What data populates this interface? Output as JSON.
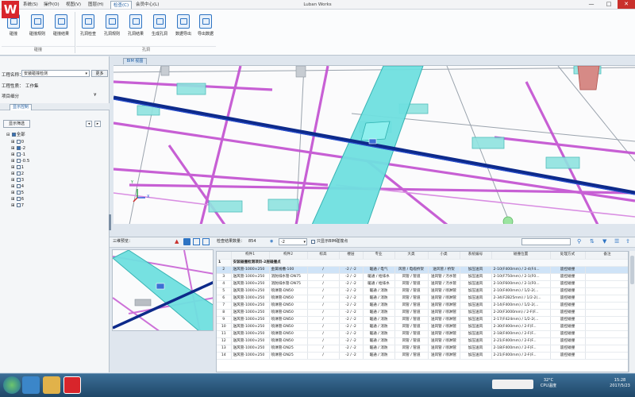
{
  "app": {
    "title": "Luban Works",
    "logo_letter": "W",
    "menu_tabs": [
      "系统(S)",
      "操作(O)",
      "视图(V)",
      "图层(H)",
      "检查(C)",
      "会员中心(L)"
    ],
    "window_buttons": [
      "—",
      "□",
      "✕"
    ]
  },
  "ribbon": {
    "buttons": [
      {
        "label": "碰撞"
      },
      {
        "label": "碰撞规则"
      },
      {
        "label": "碰撞结果"
      },
      {
        "label": "孔洞检查"
      },
      {
        "label": "孔洞规则"
      },
      {
        "label": "孔洞结果"
      },
      {
        "label": "生成孔洞"
      },
      {
        "label": "数据导出"
      },
      {
        "label": "导出数据"
      }
    ],
    "groups": [
      "碰撞",
      "孔洞"
    ]
  },
  "left_panel": {
    "project_label": "工程名称：",
    "project_value": "安装碰撞检测",
    "refresh_label": "更多",
    "type_label": "工程性质：",
    "type_value": "工作集",
    "detail_label": "项目细分",
    "tab_label": "显示控制",
    "filter_button": "显示筛选",
    "tree_root": "全部",
    "tree_items": [
      "0",
      "-2",
      "-1",
      "-0.5",
      "1",
      "2",
      "3",
      "4",
      "5",
      "6",
      "7"
    ]
  },
  "view": {
    "tab_label": "BIM 视图",
    "axis_y": "Y",
    "axis_x": "X"
  },
  "lower_bar": {
    "mini_label": "三维预览：",
    "result_count_label": "检查结果数量：",
    "result_count": "854",
    "layer_value": "-2",
    "filter_checkbox": "只显示BIM碰撞点"
  },
  "grid": {
    "headers": [
      "",
      "构件1",
      "构件2",
      "标高",
      "楼层",
      "专业",
      "大类",
      "小类",
      "系统编号",
      "碰撞位置",
      "处理方式",
      "备注"
    ],
    "group_title": "安装碰撞检测项目-2层碰撞点",
    "rows": [
      {
        "n": "2",
        "a": "送风管-1000×250",
        "b": "金属线槽-100",
        "c": "/",
        "d": "-2 / -2",
        "e": "暖通 / 电气",
        "f": "风管 / 电缆桥架",
        "g": "送风管 / 桥架",
        "h": "加压送风",
        "i": "2-10(F400mm) / 2-4(F4...",
        "j": "遥控碰撞"
      },
      {
        "n": "3",
        "a": "送风管-1000×250",
        "b": "消防排水管-DN75",
        "c": "/",
        "d": "-2 / -2",
        "e": "暖通 / 给排水",
        "f": "风管 / 管道",
        "g": "送风管 / 污水管",
        "h": "加压送风",
        "i": "2-10(F750mm) / 2-1(F0...",
        "j": "遥控碰撞"
      },
      {
        "n": "4",
        "a": "送风管-1000×250",
        "b": "消防排水管-DN75",
        "c": "/",
        "d": "-2 / -2",
        "e": "暖通 / 给排水",
        "f": "风管 / 管道",
        "g": "送风管 / 污水管",
        "h": "加压送风",
        "i": "2-10(F600mm) / 2-1(F0...",
        "j": "遥控碰撞"
      },
      {
        "n": "5",
        "a": "送风管-1000×250",
        "b": "喷淋管-DN50",
        "c": "/",
        "d": "-2 / -2",
        "e": "暖通 / 消防",
        "f": "风管 / 管道",
        "g": "送风管 / 喷淋管",
        "h": "加压送风",
        "i": "2-10(F400mm) / 1/2-2(...",
        "j": "遥控碰撞"
      },
      {
        "n": "6",
        "a": "送风管-1000×250",
        "b": "喷淋管-DN50",
        "c": "/",
        "d": "-2 / -2",
        "e": "暖通 / 消防",
        "f": "风管 / 管道",
        "g": "送风管 / 喷淋管",
        "h": "加压送风",
        "i": "2-34(F2B25mm) / 1/2-2(...",
        "j": "遥控碰撞"
      },
      {
        "n": "7",
        "a": "送风管-1000×250",
        "b": "喷淋管-DN50",
        "c": "/",
        "d": "-2 / -2",
        "e": "暖通 / 消防",
        "f": "风管 / 管道",
        "g": "送风管 / 喷淋管",
        "h": "加压送风",
        "i": "2-14(F400mm) / 1/2-2(...",
        "j": "遥控碰撞"
      },
      {
        "n": "8",
        "a": "送风管-1000×250",
        "b": "喷淋管-DN50",
        "c": "/",
        "d": "-2 / -2",
        "e": "暖通 / 消防",
        "f": "风管 / 管道",
        "g": "送风管 / 喷淋管",
        "h": "加压送风",
        "i": "2-20(F3000mm) / 2-F(F...",
        "j": "遥控碰撞"
      },
      {
        "n": "9",
        "a": "送风管-1000×250",
        "b": "喷淋管-DN50",
        "c": "/",
        "d": "-2 / -2",
        "e": "暖通 / 消防",
        "f": "风管 / 管道",
        "g": "送风管 / 喷淋管",
        "h": "加压送风",
        "i": "2-17(F424mm) / 1/2-2(...",
        "j": "遥控碰撞"
      },
      {
        "n": "10",
        "a": "送风管-1000×250",
        "b": "喷淋管-DN50",
        "c": "/",
        "d": "-2 / -2",
        "e": "暖通 / 消防",
        "f": "风管 / 管道",
        "g": "送风管 / 喷淋管",
        "h": "加压送风",
        "i": "2-30(F400mm) / 2-F(F...",
        "j": "遥控碰撞"
      },
      {
        "n": "11",
        "a": "送风管-1000×250",
        "b": "喷淋管-DN50",
        "c": "/",
        "d": "-2 / -2",
        "e": "暖通 / 消防",
        "f": "风管 / 管道",
        "g": "送风管 / 喷淋管",
        "h": "加压送风",
        "i": "2-18(F400mm) / 2-F(F...",
        "j": "遥控碰撞"
      },
      {
        "n": "12",
        "a": "送风管-1000×250",
        "b": "喷淋管-DN50",
        "c": "/",
        "d": "-2 / -2",
        "e": "暖通 / 消防",
        "f": "风管 / 管道",
        "g": "送风管 / 喷淋管",
        "h": "加压送风",
        "i": "2-21(F400mm) / 2-F(F...",
        "j": "遥控碰撞"
      },
      {
        "n": "13",
        "a": "送风管-1000×250",
        "b": "喷淋管-DN25",
        "c": "/",
        "d": "-2 / -2",
        "e": "暖通 / 消防",
        "f": "风管 / 管道",
        "g": "送风管 / 喷淋管",
        "h": "加压送风",
        "i": "2-18(F400mm) / 2-F(F...",
        "j": "遥控碰撞"
      },
      {
        "n": "14",
        "a": "送风管-1000×250",
        "b": "喷淋管-DN25",
        "c": "/",
        "d": "-2 / -2",
        "e": "暖通 / 消防",
        "f": "风管 / 管道",
        "g": "送风管 / 喷淋管",
        "h": "加压送风",
        "i": "2-21(F400mm) / 2-F(F...",
        "j": "遥控碰撞"
      }
    ]
  },
  "taskbar": {
    "temp": "32°C",
    "temp_label": "CPU温度",
    "time": "15:28",
    "date": "2017/5/23"
  },
  "colors": {
    "duct": "#6fe0e0",
    "pipe_blue": "#0d2a8a",
    "pipe_pink": "#c24fd0",
    "accent": "#2e74c3"
  }
}
